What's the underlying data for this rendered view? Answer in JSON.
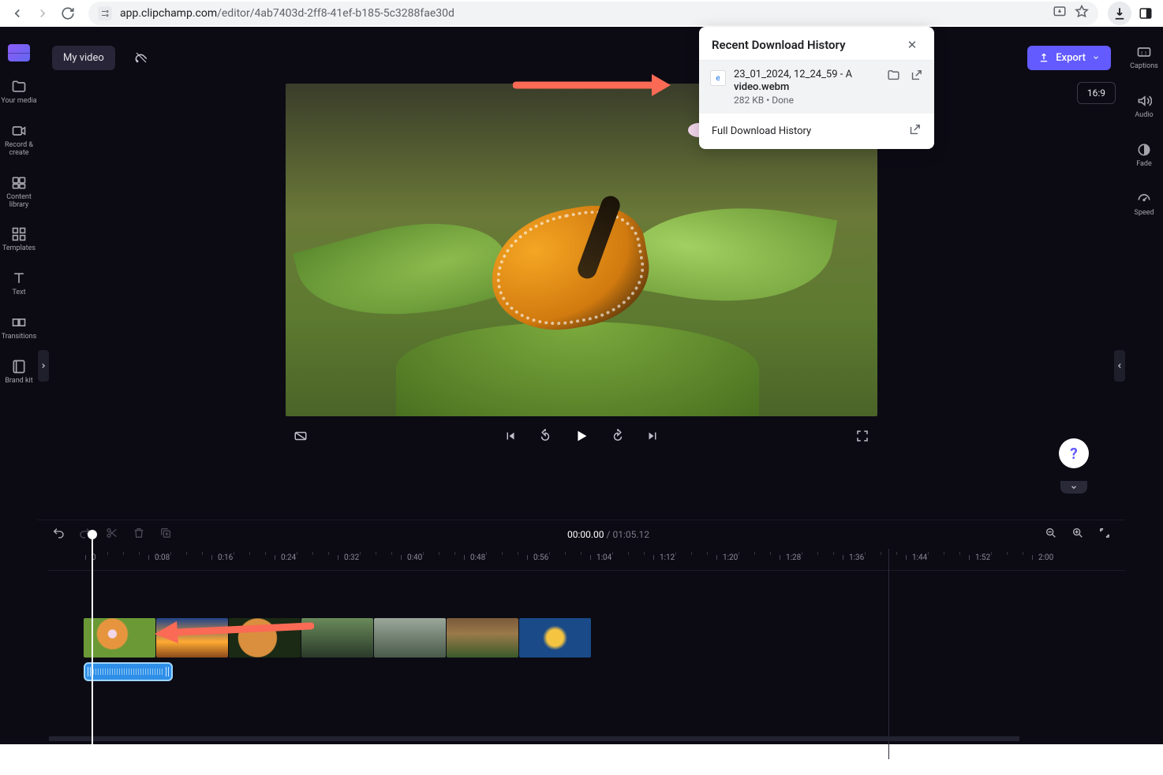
{
  "browser": {
    "url_prefix": "app.clipchamp.com",
    "url_path": "/editor/4ab7403d-2ff8-41ef-b185-5c3288fae30d"
  },
  "downloads_popup": {
    "title": "Recent Download History",
    "item": {
      "name_line1": "23_01_2024, 12_24_59 - A",
      "name_line2": "video.webm",
      "meta": "282 KB • Done"
    },
    "footer": "Full Download History"
  },
  "header": {
    "title": "My video",
    "export": "Export",
    "aspect": "16:9"
  },
  "left_rail": [
    {
      "id": "your-media",
      "label": "Your media"
    },
    {
      "id": "record-create",
      "label": "Record & create"
    },
    {
      "id": "content-library",
      "label": "Content library"
    },
    {
      "id": "templates",
      "label": "Templates"
    },
    {
      "id": "text",
      "label": "Text"
    },
    {
      "id": "transitions",
      "label": "Transitions"
    },
    {
      "id": "brand-kit",
      "label": "Brand kit"
    }
  ],
  "right_rail": [
    {
      "id": "captions",
      "label": "Captions"
    },
    {
      "id": "audio",
      "label": "Audio"
    },
    {
      "id": "fade",
      "label": "Fade"
    },
    {
      "id": "speed",
      "label": "Speed"
    }
  ],
  "timeline": {
    "current": "00:00.00",
    "duration": "01:05.12",
    "ticks": [
      "0",
      "0:08",
      "0:16",
      "0:24",
      "0:32",
      "0:40",
      "0:48",
      "0:56",
      "1:04",
      "1:12",
      "1:20",
      "1:28",
      "1:36",
      "1:44",
      "1:52",
      "2:00"
    ]
  },
  "help": "?"
}
